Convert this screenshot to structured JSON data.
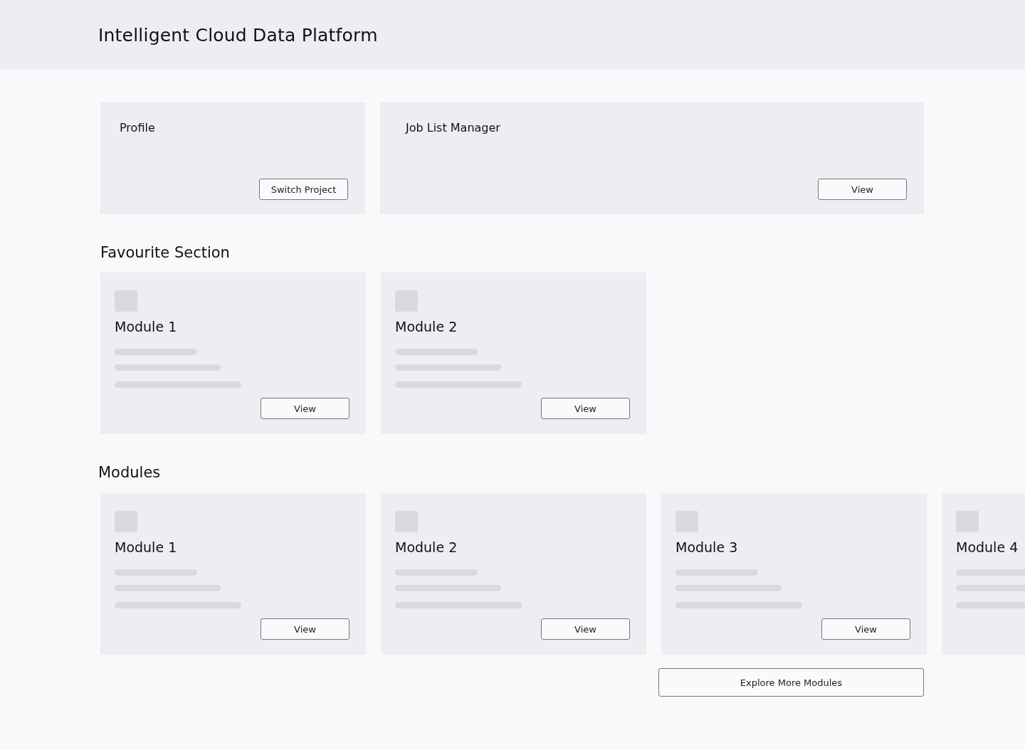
{
  "header": {
    "title": "Intelligent Cloud Data Platform"
  },
  "profile": {
    "title": "Profile",
    "button": "Switch Project"
  },
  "job_list": {
    "title": "Job List Manager",
    "button": "View"
  },
  "favourites": {
    "title": "Favourite Section",
    "items": [
      {
        "name": "Module 1",
        "button": "View"
      },
      {
        "name": "Module 2",
        "button": "View"
      }
    ]
  },
  "modules": {
    "title": "Modules",
    "items": [
      {
        "name": "Module 1",
        "button": "View"
      },
      {
        "name": "Module 2",
        "button": "View"
      },
      {
        "name": "Module 3",
        "button": "View"
      },
      {
        "name": "Module 4"
      }
    ],
    "more_button": "Explore More Modules"
  }
}
